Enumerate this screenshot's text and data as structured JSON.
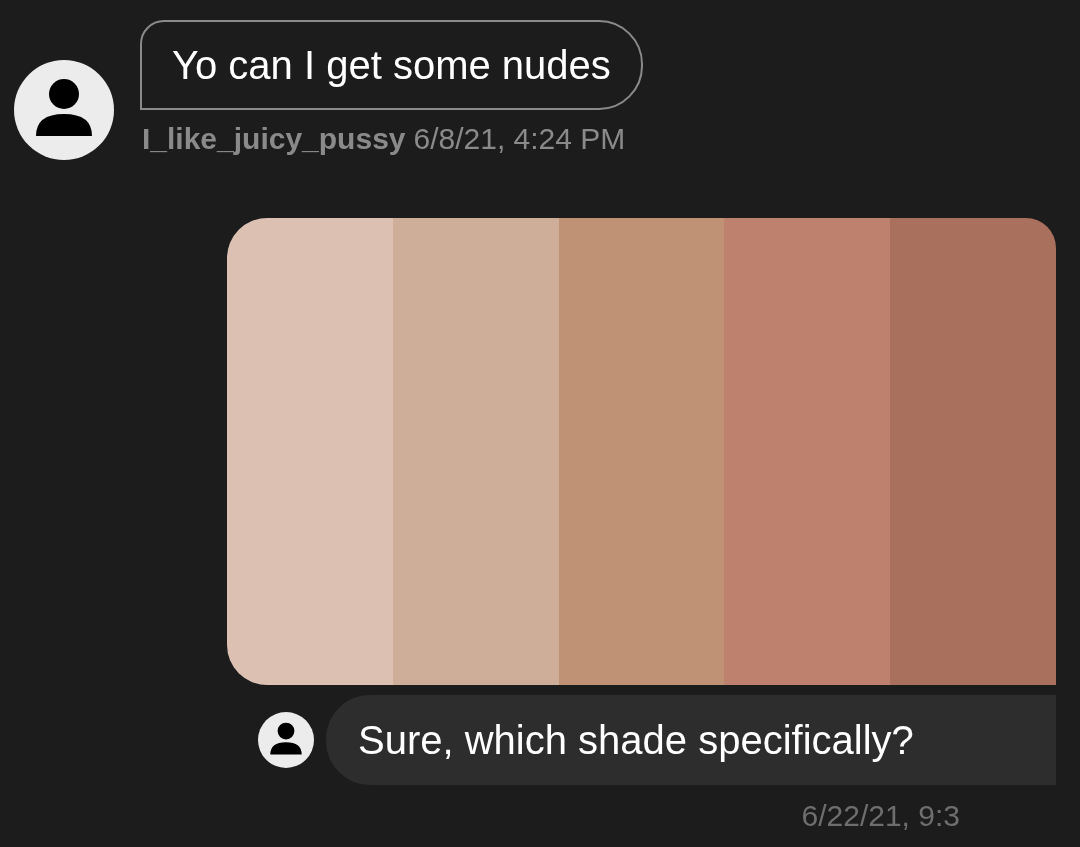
{
  "messages": [
    {
      "kind": "incoming",
      "text": "Yo can I get some nudes",
      "sender": "I_like_juicy_pussy",
      "time": "6/8/21, 4:24 PM"
    },
    {
      "kind": "swatches",
      "swatches": [
        {
          "color": "#dcc1b2"
        },
        {
          "color": "#cfae99"
        },
        {
          "color": "#bf9276"
        },
        {
          "color": "#bd816e"
        },
        {
          "color": "#a9705d"
        }
      ]
    },
    {
      "kind": "outgoing",
      "text": "Sure, which shade specifically?",
      "time": "6/22/21, 9:3"
    }
  ]
}
